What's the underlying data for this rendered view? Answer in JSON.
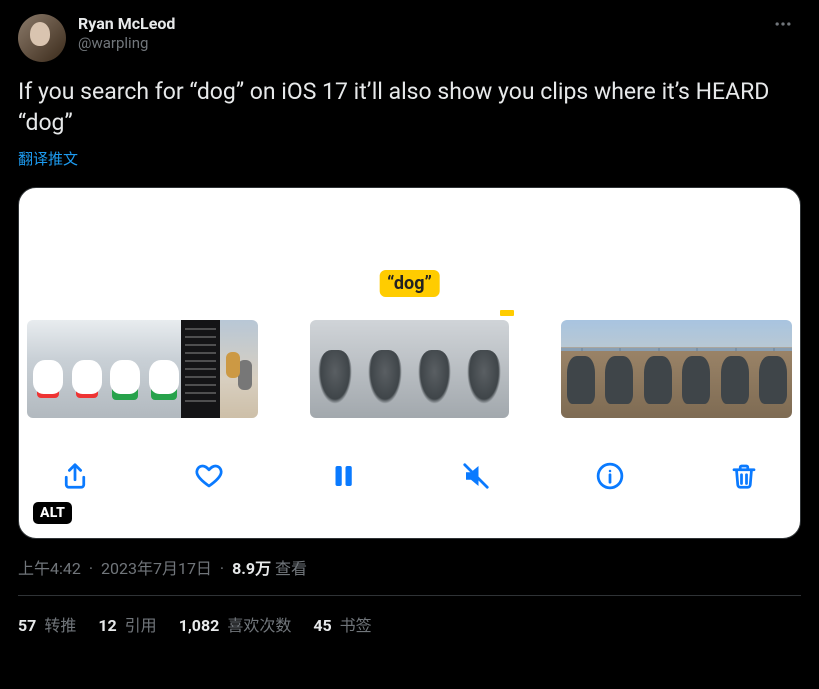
{
  "author": {
    "display_name": "Ryan McLeod",
    "handle": "@warpling"
  },
  "tweet": {
    "text": "If you search for “dog” on iOS 17 it’ll also show you clips where it’s HEARD “dog”",
    "translate_label": "翻译推文"
  },
  "media": {
    "search_token": "“dog”",
    "alt_badge": "ALT",
    "toolbar_icons": [
      "share",
      "like",
      "pause",
      "mute",
      "info",
      "trash"
    ]
  },
  "meta": {
    "time": "上午4:42",
    "date": "2023年7月17日",
    "views_number": "8.9万",
    "views_label": "查看"
  },
  "stats": {
    "retweets": {
      "count": "57",
      "label": "转推"
    },
    "quotes": {
      "count": "12",
      "label": "引用"
    },
    "likes": {
      "count": "1,082",
      "label": "喜欢次数"
    },
    "bookmarks": {
      "count": "45",
      "label": "书签"
    }
  }
}
